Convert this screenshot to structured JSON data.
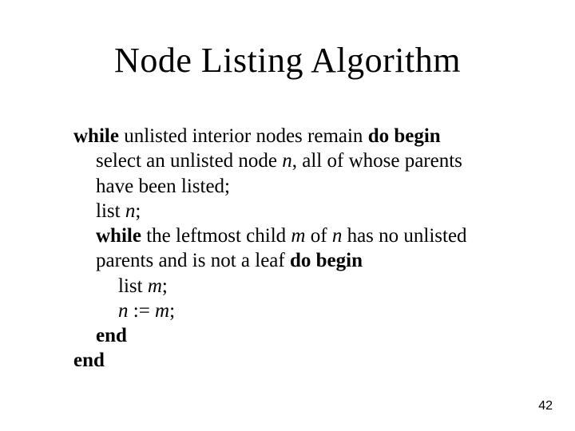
{
  "title": "Node Listing Algorithm",
  "kw": {
    "while": "while",
    "do_begin": "do begin",
    "end": "end"
  },
  "txt": {
    "unlisted_interior": " unlisted interior nodes remain ",
    "select_pre": "select an unlisted node ",
    "select_post": ", all of whose parents have been listed;",
    "list_sp": "list ",
    "semi": ";",
    "while2_pre": " the leftmost child ",
    "while2_mid": " of ",
    "while2_post": " has no unlisted parents and is not a leaf ",
    "assign": " := "
  },
  "var": {
    "n": "n",
    "m": "m"
  },
  "page": "42"
}
